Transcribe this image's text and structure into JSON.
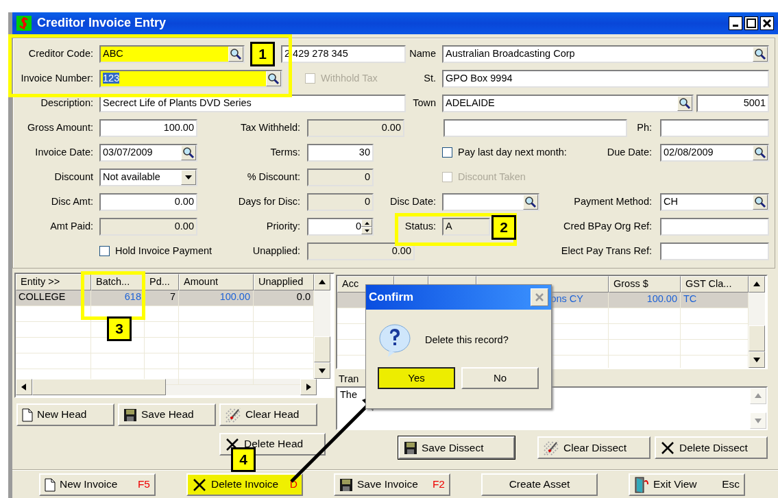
{
  "window": {
    "title": "Creditor Invoice Entry"
  },
  "form": {
    "lines": [
      {
        "items": [
          {
            "kind": "label",
            "text": "Creditor Code:"
          },
          {
            "kind": "lookup",
            "value": "ABC",
            "highlighted": true
          },
          {
            "kind": "field",
            "value": "2 429 278 345"
          },
          {
            "kind": "label",
            "text": "Name"
          },
          {
            "kind": "lookup",
            "value": "Australian Broadcasting Corp"
          }
        ]
      },
      {
        "items": [
          {
            "kind": "label",
            "text": "Invoice Number:"
          },
          {
            "kind": "lookup",
            "value": "123",
            "highlighted": true,
            "text_selected": true
          },
          {
            "kind": "checkbox",
            "text": "Withhold Tax",
            "checked": false,
            "disabled": true
          },
          {
            "kind": "label",
            "text": "St."
          },
          {
            "kind": "field",
            "value": "GPO Box 9994"
          }
        ]
      },
      {
        "items": [
          {
            "kind": "label",
            "text": "Description:"
          },
          {
            "kind": "field",
            "value": "Secrect Life of Plants DVD Series"
          },
          {
            "kind": "label",
            "text": "Town"
          },
          {
            "kind": "lookup",
            "value": "ADELAIDE"
          },
          {
            "kind": "field",
            "value": "5001"
          }
        ]
      },
      {
        "items": [
          {
            "kind": "label",
            "text": "Gross Amount:"
          },
          {
            "kind": "field",
            "value": "100.00"
          },
          {
            "kind": "label",
            "text": "Tax Withheld:"
          },
          {
            "kind": "field",
            "value": "0.00",
            "readonly": true
          },
          {
            "kind": "field"
          },
          {
            "kind": "label",
            "text": "Ph:"
          },
          {
            "kind": "field"
          }
        ]
      },
      {
        "items": [
          {
            "kind": "label",
            "text": "Invoice Date:"
          },
          {
            "kind": "lookup",
            "value": "03/07/2009"
          },
          {
            "kind": "label",
            "text": "Terms:"
          },
          {
            "kind": "field",
            "value": "30"
          },
          {
            "kind": "checkbox",
            "text": "Pay last day next month:",
            "checked": false,
            "disabled": false
          },
          {
            "kind": "label",
            "text": "Due Date:"
          },
          {
            "kind": "lookup",
            "value": "02/08/2009"
          }
        ]
      },
      {
        "items": [
          {
            "kind": "label",
            "text": "Discount"
          },
          {
            "kind": "combo",
            "value": "Not available"
          },
          {
            "kind": "label",
            "text": "% Discount:"
          },
          {
            "kind": "field",
            "value": "0",
            "readonly": true
          },
          {
            "kind": "checkbox",
            "text": "Discount Taken",
            "checked": false,
            "disabled": true
          }
        ]
      },
      {
        "items": [
          {
            "kind": "label",
            "text": "Disc Amt:"
          },
          {
            "kind": "field",
            "value": "0.00"
          },
          {
            "kind": "label",
            "text": "Days for Disc:"
          },
          {
            "kind": "field",
            "value": "0",
            "readonly": true
          },
          {
            "kind": "label",
            "text": "Disc Date:"
          },
          {
            "kind": "lookup"
          },
          {
            "kind": "label",
            "text": "Payment Method:"
          },
          {
            "kind": "lookup",
            "value": "CH"
          }
        ]
      },
      {
        "items": [
          {
            "kind": "label",
            "text": "Amt Paid:"
          },
          {
            "kind": "field",
            "value": "0.00",
            "readonly": true
          },
          {
            "kind": "label",
            "text": "Priority:"
          },
          {
            "kind": "spin",
            "value": "0"
          },
          {
            "kind": "label",
            "text": "Status:"
          },
          {
            "kind": "field",
            "value": "A",
            "readonly": true
          },
          {
            "kind": "label",
            "text": "Cred BPay Org Ref:"
          },
          {
            "kind": "field"
          }
        ]
      },
      {
        "items": [
          {
            "kind": "checkbox",
            "text": "Hold Invoice Payment",
            "checked": false,
            "disabled": false
          },
          {
            "kind": "label",
            "text": "Unapplied:"
          },
          {
            "kind": "field",
            "value": "0.00",
            "readonly": true
          },
          {
            "kind": "label",
            "text": "Elect Pay Trans Ref:"
          },
          {
            "kind": "field"
          }
        ]
      }
    ]
  },
  "head_grid": {
    "columns": [
      "Entity >>",
      "Batch...",
      "Pd...",
      "Amount",
      "Unapplied"
    ],
    "rows": [
      {
        "cells": [
          "COLLEGE",
          "618",
          "7",
          "100.00",
          "0.0"
        ],
        "selected": true
      }
    ]
  },
  "head_buttons": [
    {
      "label": "New Head"
    },
    {
      "label": "Save Head"
    },
    {
      "label": "Clear Head"
    },
    {
      "label": "Delete Head"
    }
  ],
  "dissect_grid": {
    "columns": [
      "Acc",
      null,
      null,
      null,
      "Gross $",
      "GST Cla..."
    ],
    "rows": [
      {
        "cells": [
          null,
          null,
          null,
          "ons CY",
          "100.00",
          "TC"
        ],
        "selected": true
      }
    ]
  },
  "memo": {
    "label": "Tran",
    "value": "The"
  },
  "dissect_buttons": [
    {
      "label": "Save Dissect",
      "default": true
    },
    {
      "label": "Clear Dissect",
      "default": false
    },
    {
      "label": "Delete Dissect",
      "default": false
    }
  ],
  "invoice_buttons": [
    {
      "label": "New Invoice",
      "shortcut": "F5",
      "highlighted": false
    },
    {
      "label": "Delete Invoice",
      "shortcut": "D",
      "highlighted": true
    },
    {
      "label": "Save Invoice",
      "shortcut": "F2",
      "highlighted": false
    },
    {
      "label": "Create Asset",
      "highlighted": false
    },
    {
      "label": "Exit View",
      "shortcut": "Esc",
      "highlighted": false
    }
  ],
  "dialog": {
    "title": "Confirm",
    "message": "Delete this record?",
    "buttons": [
      {
        "label": "Yes",
        "highlighted": true
      },
      {
        "label": "No",
        "highlighted": false
      }
    ]
  },
  "annotations": [
    {
      "label": "1"
    },
    {
      "label": "2"
    },
    {
      "label": "3"
    },
    {
      "label": "4"
    }
  ]
}
